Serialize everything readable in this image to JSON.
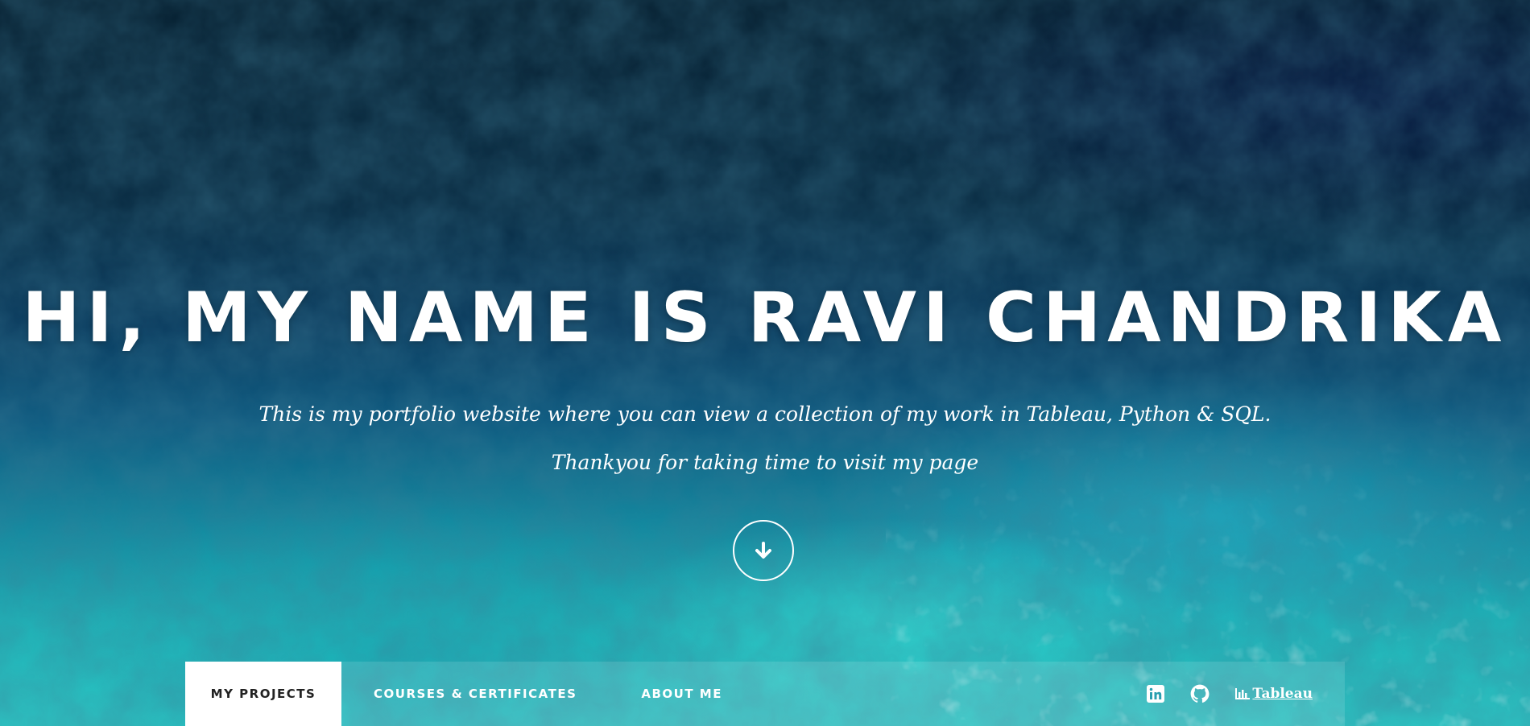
{
  "hero": {
    "headline": "HI, MY NAME IS RAVI CHANDRIKA",
    "subtitle_line1": "This is my portfolio website where you can view a collection of my work in Tableau, Python & SQL.",
    "subtitle_line2": "Thankyou for taking time to visit my page",
    "scroll_icon": "arrow-down-icon"
  },
  "nav": {
    "items": [
      {
        "label": "MY PROJECTS",
        "active": true
      },
      {
        "label": "COURSES & CERTIFICATES",
        "active": false
      },
      {
        "label": "ABOUT ME",
        "active": false
      }
    ],
    "social": [
      {
        "icon": "linkedin-icon"
      },
      {
        "icon": "github-icon"
      },
      {
        "icon": "tableau-chart-icon",
        "label": "Tableau"
      }
    ]
  },
  "colors": {
    "text": "#ffffff",
    "active_tab_bg": "#ffffff",
    "active_tab_text": "#222222",
    "ocean_dark": "#082233",
    "ocean_light": "#2bc6c4"
  }
}
